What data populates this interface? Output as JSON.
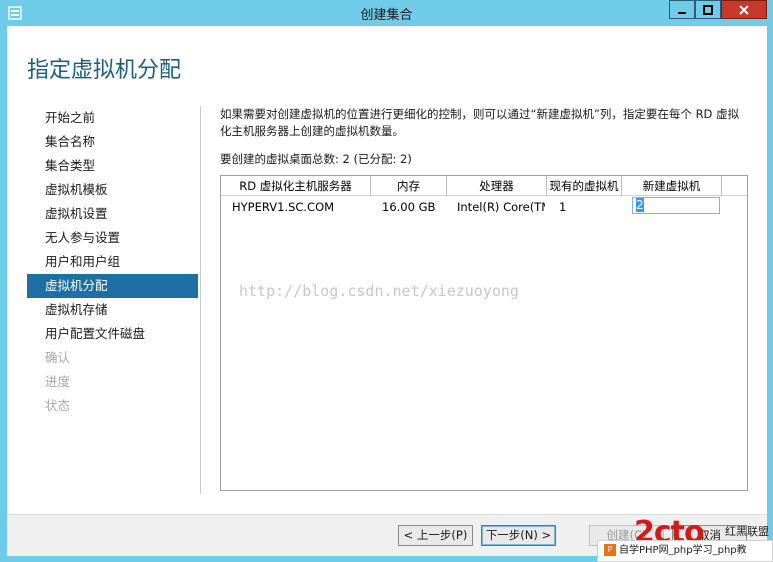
{
  "window": {
    "title": "创建集合",
    "controls": {
      "minimize": "−",
      "maximize": "□",
      "close": "×"
    }
  },
  "page": {
    "title": "指定虚拟机分配",
    "description": "如果需要对创建虚拟机的位置进行更细化的控制，则可以通过“新建虚拟机”列，指定要在每个 RD 虚拟化主机服务器上创建的虚拟机数量。",
    "total": "要创建的虚拟桌面总数: 2 (已分配: 2)"
  },
  "nav": {
    "items": [
      {
        "label": "开始之前",
        "state": "normal"
      },
      {
        "label": "集合名称",
        "state": "normal"
      },
      {
        "label": "集合类型",
        "state": "normal"
      },
      {
        "label": "虚拟机模板",
        "state": "normal"
      },
      {
        "label": "虚拟机设置",
        "state": "normal"
      },
      {
        "label": "无人参与设置",
        "state": "normal"
      },
      {
        "label": "用户和用户组",
        "state": "normal"
      },
      {
        "label": "虚拟机分配",
        "state": "active"
      },
      {
        "label": "虚拟机存储",
        "state": "normal"
      },
      {
        "label": "用户配置文件磁盘",
        "state": "normal"
      },
      {
        "label": "确认",
        "state": "disabled"
      },
      {
        "label": "进度",
        "state": "disabled"
      },
      {
        "label": "状态",
        "state": "disabled"
      }
    ]
  },
  "grid": {
    "headers": [
      "RD 虚拟化主机服务器",
      "内存",
      "处理器",
      "现有的虚拟机",
      "新建虚拟机"
    ],
    "rows": [
      {
        "server": "HYPERV1.SC.COM",
        "memory": "16.00 GB",
        "processor": "Intel(R) Core(TM",
        "existing": "1",
        "new": "2"
      }
    ]
  },
  "watermark": "http://blog.csdn.net/xiezuoyong",
  "footer": {
    "prev": "< 上一步(P)",
    "next": "下一步(N) >",
    "create": "创建(C)",
    "cancel": "取消"
  },
  "overlay": {
    "logo_text": "2cto",
    "logo_small": "红黑联盟",
    "bar_text": "自学PHP网_php学习_php教"
  },
  "colors": {
    "titlebar": "#6fcbe8",
    "accent": "#1d6fa5",
    "title_text": "#1a5f83",
    "close": "#c7392a"
  }
}
